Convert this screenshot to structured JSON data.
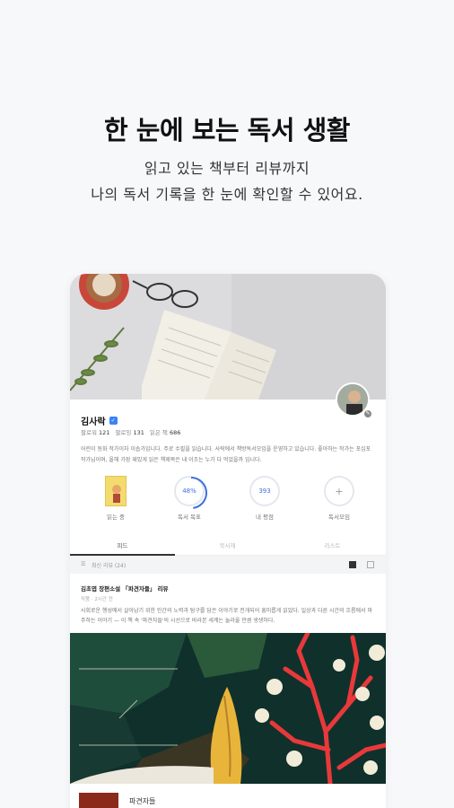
{
  "headline": "한 눈에 보는 독서 생활",
  "subtitle_line1": "읽고 있는 책부터 리뷰까지",
  "subtitle_line2": "나의 독서 기록을 한 눈에 확인할 수 있어요.",
  "profile": {
    "name": "김사락",
    "stats": [
      {
        "label": "팔로워",
        "value": "121"
      },
      {
        "label": "팔로잉",
        "value": "131"
      },
      {
        "label": "읽은 책",
        "value": "686"
      }
    ],
    "bio": "어린이 동화 작가이자 이솝가입니다. 주로 수필을 읽습니다. 사락에서 책방독서모임을 운영하고 있습니다. 좋아하는 작가는 포십포 작가님이며, 올해 가장 재밌게 읽은 책제목은 내 이조는 누가 다 먹었을까 입니다."
  },
  "circles": [
    {
      "label": "읽는 중",
      "value": ""
    },
    {
      "label": "독서 목표",
      "value": "48%"
    },
    {
      "label": "내 평점",
      "value": "393"
    },
    {
      "label": "독서모임",
      "value": "+"
    }
  ],
  "tabs": [
    {
      "label": "피드",
      "active": true
    },
    {
      "label": "북서재",
      "active": false
    },
    {
      "label": "리스트",
      "active": false
    }
  ],
  "filter": {
    "label": "최신 리뷰 (24)"
  },
  "post": {
    "title": "김초엽 장편소설 「파견자들」 리뷰",
    "meta": "작품 · 2시간 전",
    "body": "사회로운 행성에서 살아남기 위한 인간의 노력과 탐구를 담은 이야기로 전개되어 흥미롭게 읽었다. 일상과 다른 시간의 흐름에서 마주하는 이야기 — 이 책 속 '파견자들'의 시선으로 바라본 세계는 놀라울 만큼 생생하다."
  },
  "book_row": {
    "title": "파견자들"
  },
  "colors": {
    "accent": "#3b6fe0",
    "background": "#f7f8fa",
    "coral": "#e8393a"
  }
}
